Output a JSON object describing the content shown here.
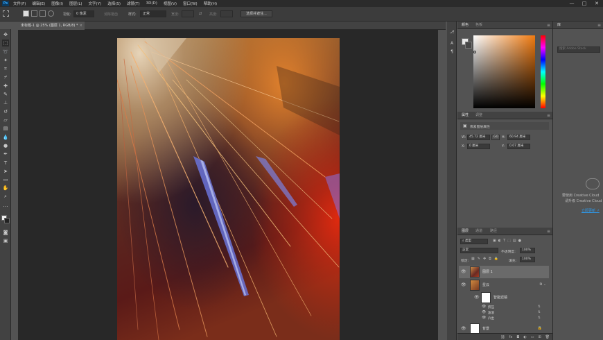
{
  "app": {
    "logo": "Ps"
  },
  "menu": [
    "文件(F)",
    "编辑(E)",
    "图像(I)",
    "图层(L)",
    "文字(Y)",
    "选择(S)",
    "滤镜(T)",
    "3D(D)",
    "视图(V)",
    "窗口(W)",
    "帮助(H)"
  ],
  "window_controls": {
    "minimize": "—",
    "maximize": "□",
    "close": "✕"
  },
  "options": {
    "feather_label": "羽化:",
    "feather_value": "0 像素",
    "antialias_label": "消除锯齿",
    "style_label": "样式:",
    "style_value": "正常",
    "width_label": "宽度:",
    "height_label": "高度:",
    "select_mask_button": "选择并遮住..."
  },
  "document_tab": {
    "title": "未标题-1 @ 25% (图层 1, RGB/8) *",
    "close": "×"
  },
  "color_panel": {
    "tab_color": "颜色",
    "tab_swatches": "色板"
  },
  "properties_panel": {
    "tab_properties": "属性",
    "tab_adjustments": "调整",
    "header": "像素图层属性",
    "w_label": "W:",
    "w_value": "45.72 厘米",
    "link_label": "GO",
    "h_label": "H:",
    "h_value": "60.94 厘米",
    "x_label": "X:",
    "x_value": "0 厘米",
    "y_label": "Y:",
    "y_value": "0.07 厘米"
  },
  "layers_panel": {
    "tab_layers": "图层",
    "tab_channels": "通道",
    "tab_paths": "路径",
    "filter_kind": "类型",
    "blend_mode": "正常",
    "opacity_label": "不透明度:",
    "opacity_value": "100%",
    "lock_label": "锁定:",
    "fill_label": "填充:",
    "fill_value": "100%",
    "layers": [
      {
        "name": "图层 1"
      },
      {
        "name": "星云"
      },
      {
        "name": "智能滤镜"
      },
      {
        "name": "挤压"
      },
      {
        "name": "波浪"
      },
      {
        "name": "凸出"
      },
      {
        "name": "背景"
      }
    ]
  },
  "library_panel": {
    "tab": "库",
    "search_placeholder": "搜索 Adobe Stock",
    "message_line1": "要使用 Creative Cloud",
    "message_line2": "请升级 Creative Cloud",
    "link": "立即更新 ↗"
  },
  "status": {
    "zoom": "25%"
  },
  "colors": {
    "menubar": "#2b2b2b",
    "panel": "#535353",
    "panel_dark": "#424242",
    "canvas_bg": "#282828",
    "accent_link": "#2d9cf0"
  }
}
